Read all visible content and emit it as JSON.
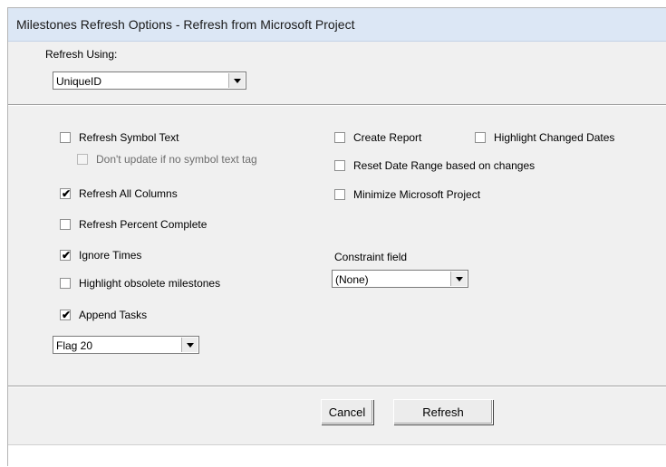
{
  "window": {
    "title": "Milestones Refresh Options - Refresh from Microsoft Project"
  },
  "refresh_using": {
    "label": "Refresh Using:",
    "value": "UniqueID"
  },
  "options": {
    "refresh_symbol_text": {
      "label": "Refresh Symbol Text",
      "checked": false
    },
    "dont_update_no_tag": {
      "label": "Don't update if no symbol text tag",
      "checked": false,
      "disabled": true
    },
    "refresh_all_columns": {
      "label": "Refresh All Columns",
      "checked": true
    },
    "refresh_percent_complete": {
      "label": "Refresh Percent Complete",
      "checked": false
    },
    "ignore_times": {
      "label": "Ignore Times",
      "checked": true
    },
    "highlight_obsolete": {
      "label": "Highlight obsolete milestones",
      "checked": false
    },
    "append_tasks": {
      "label": "Append Tasks",
      "checked": true
    },
    "create_report": {
      "label": "Create Report",
      "checked": false
    },
    "highlight_changed_dates": {
      "label": "Highlight Changed Dates",
      "checked": false
    },
    "reset_date_range": {
      "label": "Reset Date Range based on changes",
      "checked": false
    },
    "minimize_project": {
      "label": "Minimize Microsoft Project",
      "checked": false
    }
  },
  "append_flag": {
    "value": "Flag 20"
  },
  "constraint_field": {
    "label": "Constraint field",
    "value": "(None)"
  },
  "buttons": {
    "cancel": "Cancel",
    "refresh": "Refresh"
  },
  "check_glyph": "✔"
}
